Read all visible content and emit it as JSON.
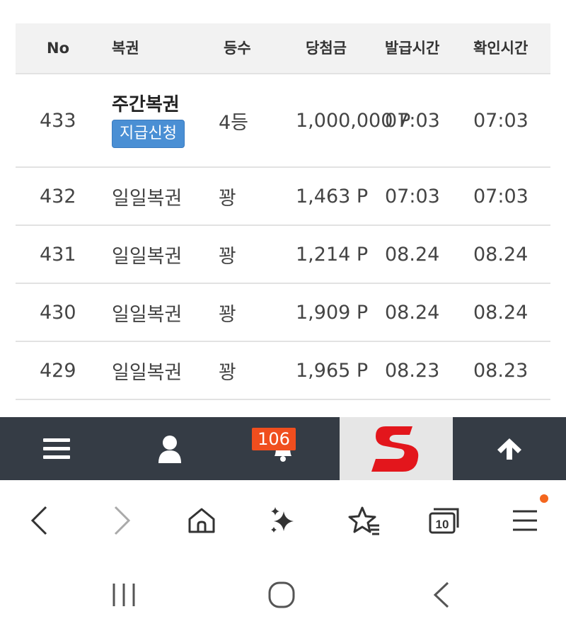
{
  "table": {
    "headers": {
      "no": "No",
      "lotto": "복권",
      "rank": "등수",
      "prize": "당첨금",
      "issue_time": "발급시간",
      "check_time": "확인시간"
    },
    "rows": [
      {
        "no": "433",
        "lotto": "주간복권",
        "claim_label": "지급신청",
        "rank": "4등",
        "prize": "1,000,000 P",
        "issue_time": "07:03",
        "check_time": "07:03"
      },
      {
        "no": "432",
        "lotto": "일일복권",
        "rank": "꽝",
        "prize": "1,463 P",
        "issue_time": "07:03",
        "check_time": "07:03"
      },
      {
        "no": "431",
        "lotto": "일일복권",
        "rank": "꽝",
        "prize": "1,214 P",
        "issue_time": "08.24",
        "check_time": "08.24"
      },
      {
        "no": "430",
        "lotto": "일일복권",
        "rank": "꽝",
        "prize": "1,909 P",
        "issue_time": "08.24",
        "check_time": "08.24"
      },
      {
        "no": "429",
        "lotto": "일일복권",
        "rank": "꽝",
        "prize": "1,965 P",
        "issue_time": "08.23",
        "check_time": "08.23"
      }
    ]
  },
  "site_nav": {
    "notification_count": "106",
    "icons": [
      "menu-icon",
      "user-icon",
      "bell-icon",
      "logo",
      "arrow-up-icon"
    ],
    "logo_letter": "S",
    "colors": {
      "bar": "#353c45",
      "badge": "#f04e1e",
      "logo": "#e3161c"
    }
  },
  "browser_bar": {
    "icons": [
      "back-icon",
      "forward-icon",
      "home-icon",
      "sparkle-icon",
      "bookmark-star-icon",
      "tabs-icon",
      "menu-icon"
    ],
    "tab_count": "10"
  },
  "system_nav": {
    "icons": [
      "recents-icon",
      "home-circle-icon",
      "back-chevron-icon"
    ]
  }
}
